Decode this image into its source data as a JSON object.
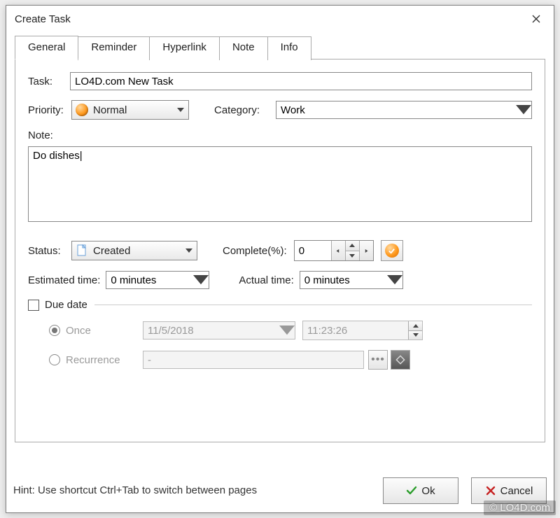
{
  "window": {
    "title": "Create Task"
  },
  "tabs": [
    "General",
    "Reminder",
    "Hyperlink",
    "Note",
    "Info"
  ],
  "active_tab": 0,
  "labels": {
    "task": "Task:",
    "priority": "Priority:",
    "category": "Category:",
    "note": "Note:",
    "status": "Status:",
    "complete": "Complete(%):",
    "estimated_time": "Estimated time:",
    "actual_time": "Actual time:",
    "due_date": "Due date",
    "once": "Once",
    "recurrence": "Recurrence"
  },
  "values": {
    "task": "LO4D.com New Task",
    "priority": "Normal",
    "category": "Work",
    "note": "Do dishes",
    "status": "Created",
    "complete": "0",
    "estimated_time": "0 minutes",
    "actual_time": "0 minutes",
    "due_date_checked": false,
    "due_date_mode": "once",
    "due_date": "11/5/2018",
    "due_time": "11:23:26",
    "recurrence_text": "-"
  },
  "buttons": {
    "ok": "Ok",
    "cancel": "Cancel"
  },
  "hint": "Hint: Use shortcut Ctrl+Tab to switch between pages",
  "watermark": "© LO4D.com"
}
